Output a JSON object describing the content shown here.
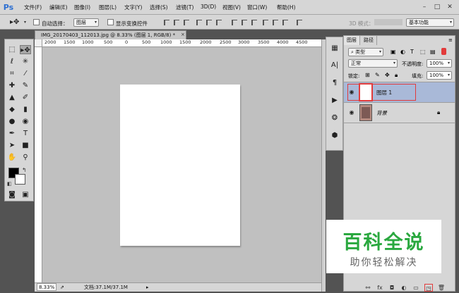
{
  "app": {
    "logo": "Ps"
  },
  "menubar": {
    "items": [
      "文件(F)",
      "编辑(E)",
      "图像(I)",
      "图层(L)",
      "文字(Y)",
      "选择(S)",
      "滤镜(T)",
      "3D(D)",
      "视图(V)",
      "窗口(W)",
      "帮助(H)"
    ],
    "window_controls": [
      "–",
      "□",
      "✕"
    ]
  },
  "options": {
    "auto_select_label": "自动选择：",
    "auto_select_value": "图层",
    "show_transform_label": "显示变换控件",
    "mode_3d_label": "3D 模式：",
    "workspace_value": "基本功能"
  },
  "document": {
    "tab_title": "IMG_20170403_112013.jpg @ 8.33% (图层 1, RGB/8) *",
    "close_glyph": "×",
    "ruler_labels": [
      "2000",
      "1500",
      "1000",
      "500",
      "0",
      "500",
      "1000",
      "1500",
      "2000",
      "2500",
      "3000",
      "3500",
      "4000",
      "4500"
    ],
    "zoom": "8.33%",
    "doc_info": "文档:37.1M/37.1M"
  },
  "layers_panel": {
    "tabs": [
      "图层",
      "路径"
    ],
    "filter_value": "类型",
    "blend_mode": "正常",
    "opacity_label": "不透明度:",
    "opacity_value": "100%",
    "lock_label": "锁定:",
    "fill_label": "填充:",
    "fill_value": "100%",
    "layers": [
      {
        "name": "图层 1",
        "selected": true
      },
      {
        "name": "背景",
        "selected": false,
        "locked": true
      }
    ]
  },
  "watermark": {
    "main": "百科全说",
    "sub": "助你轻松解决"
  },
  "colors": {
    "accent": "#2d6fd1",
    "layer_selected": "#a9b9d8",
    "highlight_red": "#e23b3b",
    "watermark_green": "#2aa83f"
  }
}
